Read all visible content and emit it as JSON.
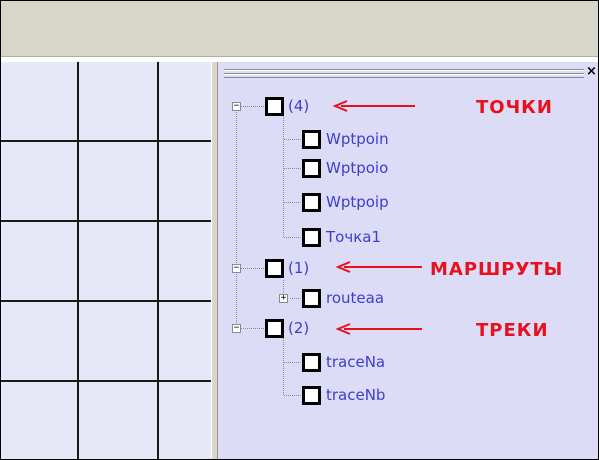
{
  "tree": {
    "groups": [
      {
        "count_label": "(4)",
        "expander": "−",
        "annotation": "ТОЧКИ",
        "children": [
          {
            "label": "Wptpoin"
          },
          {
            "label": "Wptpoio"
          },
          {
            "label": "Wptpoip"
          },
          {
            "label": "Точка1"
          }
        ]
      },
      {
        "count_label": "(1)",
        "expander": "−",
        "annotation": "МАРШРУТЫ",
        "children": [
          {
            "label": "routeaa",
            "expander": "+"
          }
        ]
      },
      {
        "count_label": "(2)",
        "expander": "−",
        "annotation": "ТРЕКИ",
        "children": [
          {
            "label": "traceNa"
          },
          {
            "label": "traceNb"
          }
        ]
      }
    ]
  },
  "panel": {
    "close_glyph": "×"
  },
  "colors": {
    "label": "#3d3dcf",
    "annotation": "#e8101c",
    "panel_bg": "#dcdcf6",
    "map_bg": "#e6e8f8",
    "toolbar_bg": "#d8d6c8"
  },
  "icons": [
    "close-icon",
    "expander-minus-icon",
    "expander-plus-icon",
    "checkbox-icon",
    "red-arrow-icon"
  ]
}
